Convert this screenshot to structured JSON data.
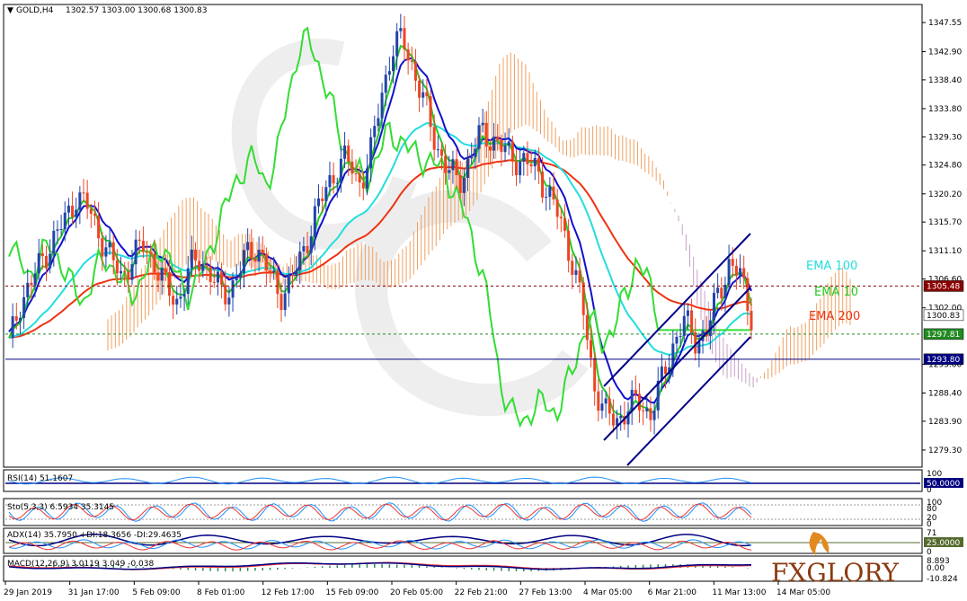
{
  "header": {
    "symbol": "GOLD,H4",
    "ohlc": "1302.57 1303.00 1300.68 1300.83"
  },
  "colors": {
    "ema10": "#22cc22",
    "ema100": "#22dddd",
    "ema200": "#ee3311",
    "kijun": "#1111cc",
    "chikou": "#33dd33",
    "cloud_bull": "#f0a060",
    "cloud_bear": "#c8a0c8",
    "bull_candle": "#2244aa",
    "bear_candle": "#ee4422",
    "channel": "#000088"
  },
  "legend": {
    "ema100": "EMA 100",
    "ema10": "EMA 10",
    "ema200": "EMA 200"
  },
  "price_axis": {
    "ticks": [
      "1347.55",
      "1342.90",
      "1338.40",
      "1333.80",
      "1329.30",
      "1324.80",
      "1320.20",
      "1315.70",
      "1311.10",
      "1306.60",
      "1302.00",
      "1293.00",
      "1288.40",
      "1283.90",
      "1279.30"
    ],
    "tags": {
      "resistance": "1305.48",
      "last": "1300.83",
      "support": "1297.81",
      "low_line": "1293.80"
    }
  },
  "time_axis": [
    "29 Jan 2019",
    "31 Jan 17:00",
    "5 Feb 09:00",
    "8 Feb 01:00",
    "12 Feb 17:00",
    "15 Feb 09:00",
    "20 Feb 05:00",
    "22 Feb 21:00",
    "27 Feb 13:00",
    "4 Mar 05:00",
    "6 Mar 21:00",
    "11 Mar 13:00",
    "14 Mar 05:00"
  ],
  "rsi": {
    "label": "RSI(14) 51.1607",
    "ticks": [
      "100",
      "50.0000",
      "0"
    ]
  },
  "stoch": {
    "label": "Sto(5,3,3) 6.5934 35.3145",
    "ticks": [
      "100",
      "80",
      "20",
      "0"
    ]
  },
  "adx": {
    "label": "ADX(14) 35.7950 +DI:18.3656 -DI:29.4635",
    "ticks": [
      "71",
      "25.0000",
      "0"
    ]
  },
  "macd": {
    "label": "MACD(12,26,9) 3.0119 3.049 -0.038",
    "ticks": [
      "8.893",
      "0.00",
      "-10.824"
    ]
  },
  "brand": "FXGLORY",
  "chart_data": {
    "type": "candlestick",
    "ylim": [
      1277,
      1350
    ],
    "resistance": 1305.48,
    "support": 1297.81,
    "horizontal_line": 1293.8,
    "last_price": 1300.83,
    "close_path": [
      1296,
      1303,
      1306,
      1310,
      1313,
      1316,
      1320,
      1318,
      1314,
      1310,
      1307,
      1310,
      1312,
      1309,
      1305,
      1303,
      1308,
      1310,
      1307,
      1304,
      1306,
      1310,
      1312,
      1308,
      1304,
      1306,
      1310,
      1316,
      1320,
      1324,
      1326,
      1322,
      1325,
      1335,
      1343,
      1345,
      1340,
      1334,
      1328,
      1324,
      1322,
      1326,
      1330,
      1329,
      1327,
      1326,
      1325,
      1324,
      1320,
      1316,
      1310,
      1302,
      1290,
      1285,
      1284,
      1286,
      1287,
      1285,
      1290,
      1296,
      1300,
      1297,
      1298,
      1304,
      1309,
      1307,
      1301
    ]
  }
}
